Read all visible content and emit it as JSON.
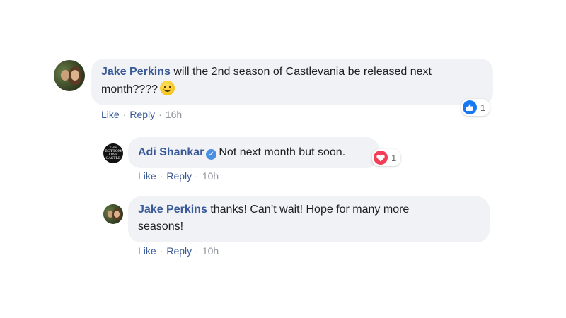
{
  "comments": [
    {
      "author": "Jake Perkins",
      "text": "will the 2nd season of Castlevania be released next",
      "text2": "month????",
      "actions": {
        "like": "Like",
        "reply": "Reply",
        "time": "16h"
      },
      "reaction": {
        "type": "like",
        "count": "1"
      }
    },
    {
      "author": "Adi Shankar",
      "text": "Not next month but soon.",
      "actions": {
        "like": "Like",
        "reply": "Reply",
        "time": "10h"
      },
      "reaction": {
        "type": "love",
        "count": "1"
      }
    },
    {
      "author": "Jake Perkins",
      "text": "thanks! Can’t wait! Hope for many more",
      "text2": "seasons!",
      "actions": {
        "like": "Like",
        "reply": "Reply",
        "time": "10h"
      }
    }
  ],
  "icons": {
    "avatar_logo_text": "THE BOTTOM LINE CASTLE",
    "emoji": "slightly-smiling-face",
    "verified": "verified-badge",
    "like": "thumbs-up",
    "love": "heart"
  },
  "colors": {
    "author": "#385898",
    "bubble": "#f0f2f5",
    "like_blue": "#1877f2",
    "love_red": "#f33e58",
    "verified_blue": "#4a90e2"
  }
}
